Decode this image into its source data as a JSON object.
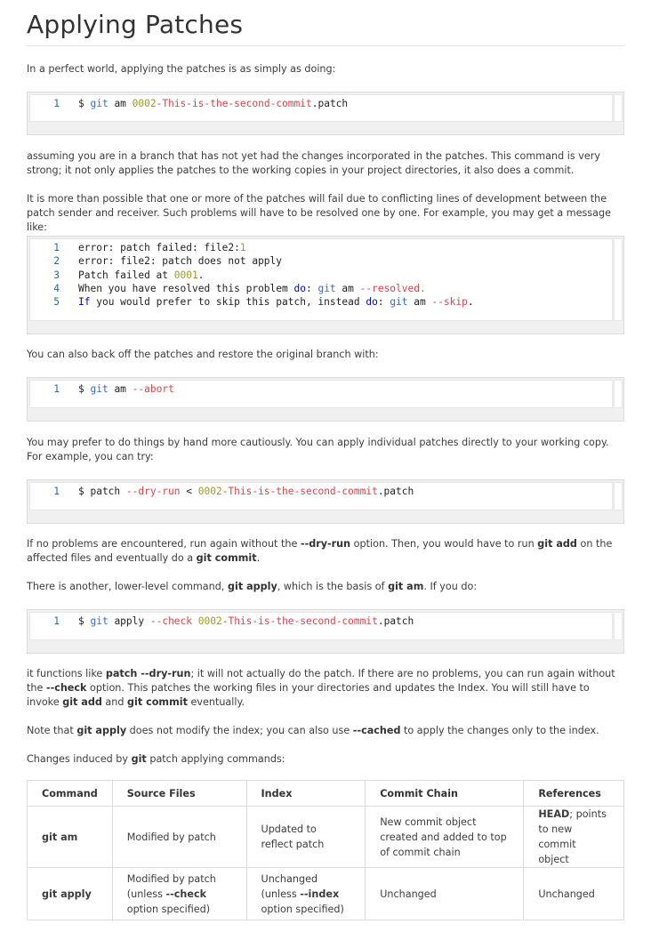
{
  "title": "Applying Patches",
  "p1": "In a perfect world, applying the patches is as simply as doing:",
  "code1": {
    "lines": [
      {
        "n": "1",
        "parts": [
          [
            "",
            "$ "
          ],
          [
            "kw",
            "git"
          ],
          [
            "",
            " am "
          ],
          [
            "num",
            "0002"
          ],
          [
            "str",
            "-This-is-the-second-commit"
          ],
          [
            "",
            ".patch"
          ]
        ]
      }
    ]
  },
  "p2": "assuming you are in a branch that has not yet had the changes incorporated in the patches. This command is very strong; it not only applies the patches to the working copies in your project directories, it also does a commit.",
  "p3": "It is more than possible that one or more of the patches will fail due to conflicting lines of development between the patch sender and receiver. Such problems will have to be resolved one by one. For example, you may get a message like:",
  "code2": {
    "lines": [
      {
        "n": "1",
        "parts": [
          [
            "",
            "error: patch failed: file2:"
          ],
          [
            "num",
            "1"
          ]
        ]
      },
      {
        "n": "2",
        "parts": [
          [
            "",
            "error: file2: patch does not apply"
          ]
        ]
      },
      {
        "n": "3",
        "parts": [
          [
            "",
            "Patch failed at "
          ],
          [
            "num",
            "0001"
          ],
          [
            "",
            "."
          ]
        ]
      },
      {
        "n": "4",
        "parts": [
          [
            "",
            "When you have resolved this problem "
          ],
          [
            "bl",
            "do"
          ],
          [
            "",
            ": "
          ],
          [
            "kw",
            "git"
          ],
          [
            "",
            " am "
          ],
          [
            "str",
            "--resolved."
          ]
        ]
      },
      {
        "n": "5",
        "parts": [
          [
            "bl",
            "If"
          ],
          [
            "",
            " you would prefer to skip this patch, instead "
          ],
          [
            "bl",
            "do"
          ],
          [
            "",
            ": "
          ],
          [
            "kw",
            "git"
          ],
          [
            "",
            " am "
          ],
          [
            "str",
            "--skip"
          ],
          [
            "",
            "."
          ]
        ]
      }
    ]
  },
  "p4": "You can also back off the patches and restore the original branch with:",
  "code3": {
    "lines": [
      {
        "n": "1",
        "parts": [
          [
            "",
            "$ "
          ],
          [
            "kw",
            "git"
          ],
          [
            "",
            " am "
          ],
          [
            "str",
            "--abort"
          ]
        ]
      }
    ]
  },
  "p5": "You may prefer to do things by hand more cautiously. You can apply individual patches directly to your working copy. For example, you can try:",
  "code4": {
    "lines": [
      {
        "n": "1",
        "parts": [
          [
            "",
            "$ patch "
          ],
          [
            "str",
            "--dry-run"
          ],
          [
            "",
            " < "
          ],
          [
            "num",
            "0002"
          ],
          [
            "str",
            "-This-is-the-second-commit"
          ],
          [
            "",
            ".patch"
          ]
        ]
      }
    ]
  },
  "p6": {
    "a": "If no problems are encountered, run again without the ",
    "b": "--dry-run",
    "c": " option. Then, you would have to run ",
    "d": "git add",
    "e": " on the affected files and eventually do a ",
    "f": "git commit",
    "g": "."
  },
  "p7": {
    "a": "There is another, lower-level command, ",
    "b": "git apply",
    "c": ", which is the basis of ",
    "d": "git am",
    "e": ". If you do:"
  },
  "code5": {
    "lines": [
      {
        "n": "1",
        "parts": [
          [
            "",
            "$ "
          ],
          [
            "kw",
            "git"
          ],
          [
            "",
            " apply "
          ],
          [
            "str",
            "--check"
          ],
          [
            "",
            " "
          ],
          [
            "num",
            "0002"
          ],
          [
            "str",
            "-This-is-the-second-commit"
          ],
          [
            "",
            ".patch"
          ]
        ]
      }
    ]
  },
  "p8": {
    "a": "it functions like ",
    "b": "patch --dry-run",
    "c": "; it will not actually do the patch. If there are no problems, you can run again without the ",
    "d": "--check",
    "e": " option. This patches the working files in your directories and updates the Index. You will still have to invoke ",
    "f": "git add",
    "g": " and ",
    "h": "git commit",
    "i": " eventually."
  },
  "p9": {
    "a": "Note that ",
    "b": "git apply",
    "c": " does not modify the index; you can also use ",
    "d": "--cached",
    "e": " to apply the changes only to the index."
  },
  "p10": {
    "a": "Changes induced by ",
    "b": "git",
    "c": " patch applying commands:"
  },
  "table": {
    "headers": [
      "Command",
      "Source Files",
      "Index",
      "Commit Chain",
      "References"
    ],
    "rows": [
      {
        "cmd": "git am",
        "src": "Modified by patch",
        "idx": "Updated to reflect patch",
        "chain": "New commit object created and added to top of commit chain",
        "ref_b": "HEAD",
        "ref": "; points to new commit object"
      },
      {
        "cmd": "git apply",
        "src_a": "Modified by patch (unless ",
        "src_b": "--check",
        "src_c": " option specified)",
        "idx_a": "Unchanged (unless ",
        "idx_b": "--index",
        "idx_c": " option specified)",
        "chain": "Unchanged",
        "ref": "Unchanged"
      }
    ]
  }
}
